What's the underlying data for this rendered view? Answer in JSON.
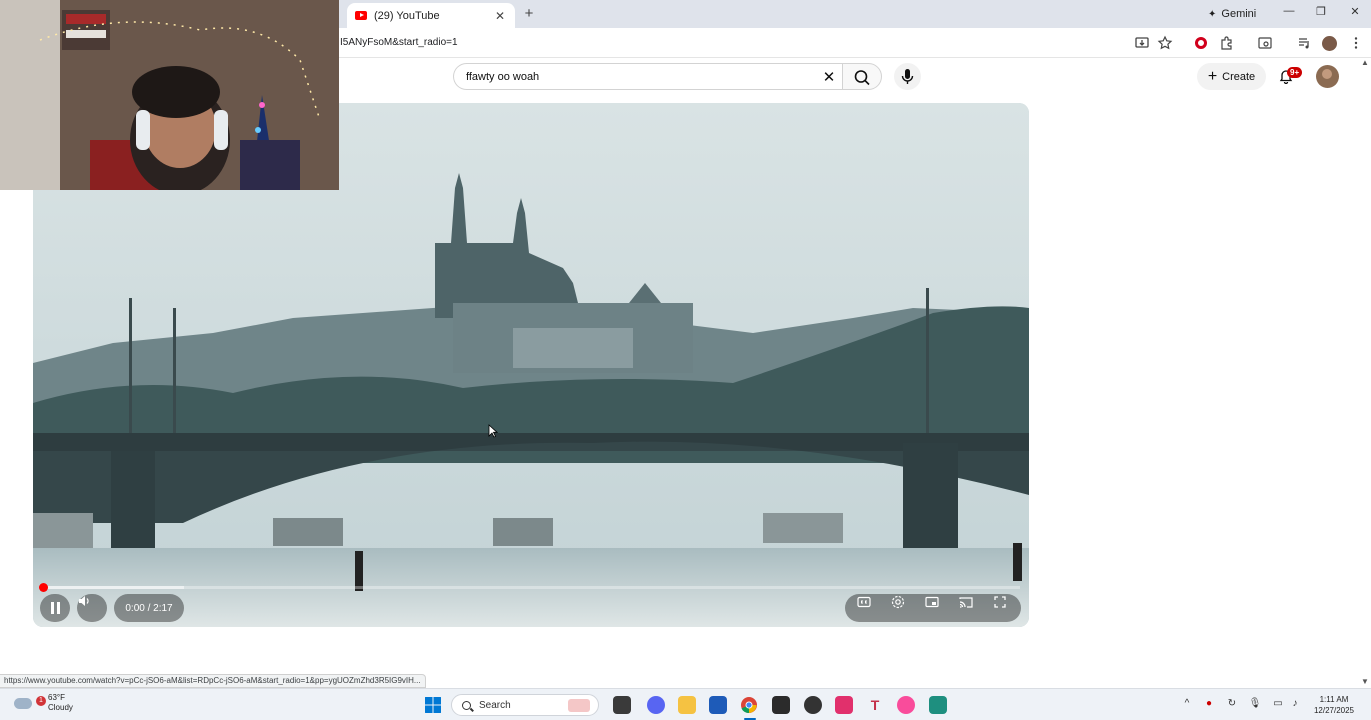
{
  "browser": {
    "tab_title": "(29) YouTube",
    "tab_close": "✕",
    "new_tab": "+",
    "gemini_label": "Gemini",
    "url_fragment": "I5ANyFsoM&start_radio=1",
    "window_controls": [
      "—",
      "❐",
      "✕"
    ]
  },
  "youtube": {
    "search": {
      "value": "ffawty oo woah",
      "clear_glyph": "✕"
    },
    "create_label": "Create",
    "notifications_badge": "9+"
  },
  "player": {
    "time_display": "0:00 / 2:17",
    "progress": 0.0,
    "state": "playing",
    "controls": [
      "pause-icon",
      "volume-icon",
      "captions-icon",
      "settings-icon",
      "miniplayer-icon",
      "cast-icon",
      "fullscreen-icon"
    ]
  },
  "status_bar": {
    "hover_url": "https://www.youtube.com/watch?v=pCc-jSO6-aM&list=RDpCc-jSO6-aM&start_radio=1&pp=ygUOZmZhd3R5IG9vIH..."
  },
  "taskbar": {
    "weather_temp": "63°F",
    "weather_desc": "Cloudy",
    "weather_badge": "1",
    "search_label": "Search",
    "time": "1:11 AM",
    "date": "12/27/2025",
    "accent": "#0067c0"
  },
  "colors": {
    "youtube_red": "#ff0000",
    "notification_red": "#cc0000"
  }
}
